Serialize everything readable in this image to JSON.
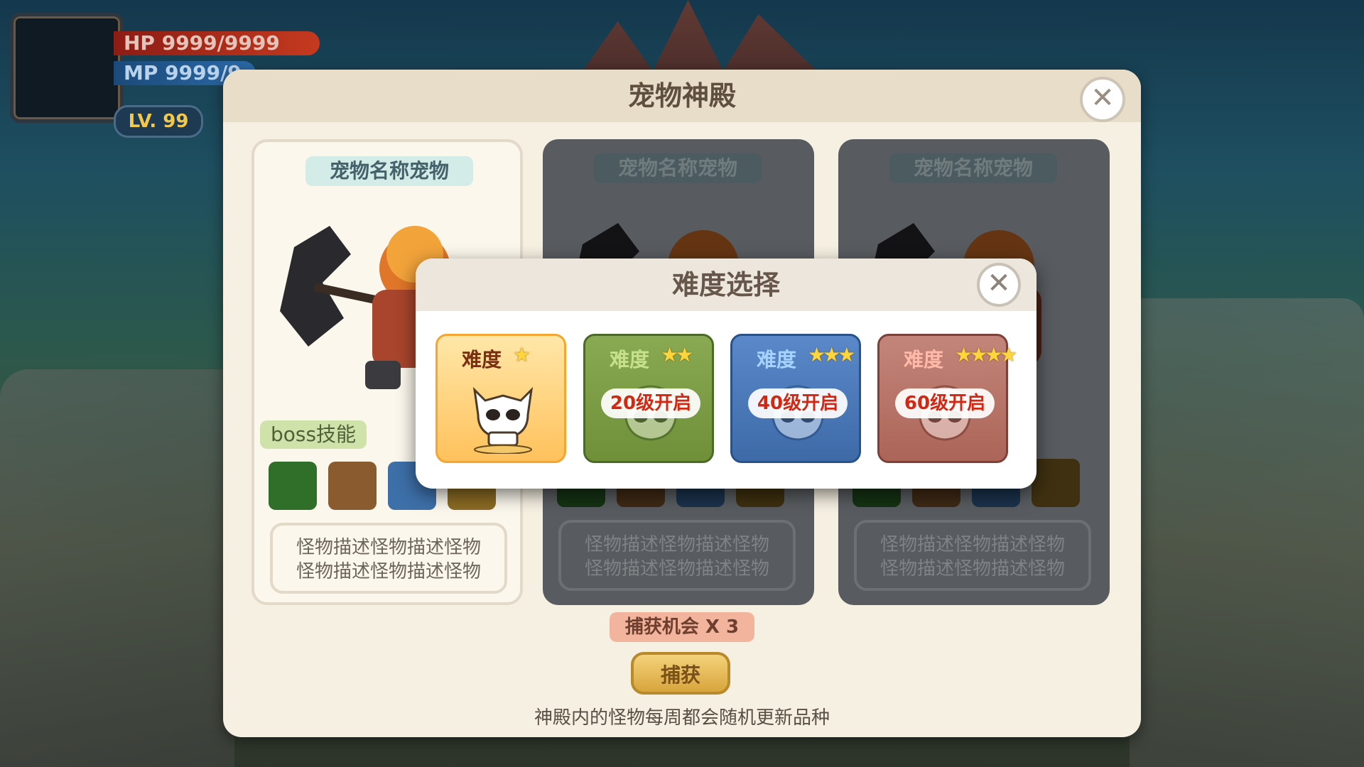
{
  "hud": {
    "hp_label": "HP",
    "hp_value": "9999/9999",
    "mp_label": "MP",
    "mp_value": "9999/9",
    "level": "LV. 99"
  },
  "panel": {
    "title": "宠物神殿",
    "cards": [
      {
        "pet_name": "宠物名称宠物",
        "boss_skill_label": "boss技能",
        "desc_line1": "怪物描述怪物描述怪物",
        "desc_line2": "怪物描述怪物描述怪物"
      },
      {
        "pet_name": "宠物名称宠物",
        "desc_line1": "怪物描述怪物描述怪物",
        "desc_line2": "怪物描述怪物描述怪物"
      },
      {
        "pet_name": "宠物名称宠物",
        "desc_line1": "怪物描述怪物描述怪物",
        "desc_line2": "怪物描述怪物描述怪物"
      }
    ],
    "capture_chance": "捕获机会 X 3",
    "capture_button": "捕获",
    "note": "神殿内的怪物每周都会随机更新品种"
  },
  "modal": {
    "title": "难度选择",
    "difficulties": [
      {
        "label": "难度",
        "stars": "★",
        "lock": ""
      },
      {
        "label": "难度",
        "stars": "★★",
        "lock": "20级开启"
      },
      {
        "label": "难度",
        "stars": "★★★",
        "lock": "40级开启"
      },
      {
        "label": "难度",
        "stars": "★★★★",
        "lock": "60级开启"
      }
    ]
  },
  "colors": {
    "panel_bg": "#f6f0e2",
    "accent_orange": "#ffc15c",
    "locked_red": "#d32712"
  },
  "icons": [
    "close-icon",
    "skull-icon",
    "star-icon",
    "skill-heal-icon",
    "skill-fist-icon",
    "skill-shield-icon",
    "skill-ring-icon"
  ]
}
